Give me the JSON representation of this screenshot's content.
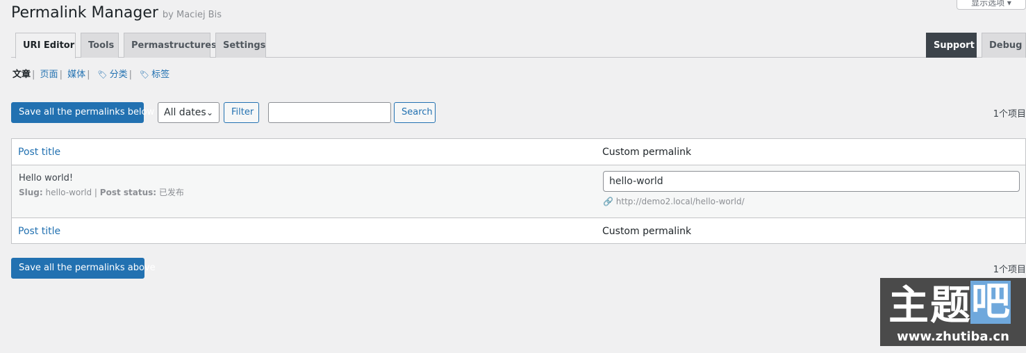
{
  "header": {
    "title": "Permalink Manager",
    "by": "by Maciej Bis",
    "screen_options": "显示选项 ▾"
  },
  "tabs": [
    {
      "label": "URI Editor",
      "active": true
    },
    {
      "label": "Tools"
    },
    {
      "label": "Permastructures"
    },
    {
      "label": "Settings"
    }
  ],
  "right_tabs": [
    {
      "label": "Support"
    },
    {
      "label": "Debug"
    }
  ],
  "subnav": {
    "posts": "文章",
    "pages": "页面",
    "media": "媒体",
    "categories": "分类",
    "tags": "标签"
  },
  "toolbar": {
    "save_below": "Save all the permalinks below",
    "date_select": "All dates",
    "filter": "Filter",
    "search_value": "",
    "search": "Search",
    "count": "1个项目"
  },
  "table": {
    "col_title": "Post title",
    "col_permalink": "Custom permalink",
    "rows": [
      {
        "title": "Hello world!",
        "slug_label": "Slug:",
        "slug": "hello-world",
        "status_label": "Post status:",
        "status": "已发布",
        "permalink": "hello-world",
        "url": "http://demo2.local/hello-world/"
      }
    ]
  },
  "footer": {
    "save_above": "Save all the permalinks above",
    "count": "1个项目"
  },
  "watermark": {
    "text": "主题",
    "box_text": "吧",
    "url": "www.zhutiba.cn"
  }
}
